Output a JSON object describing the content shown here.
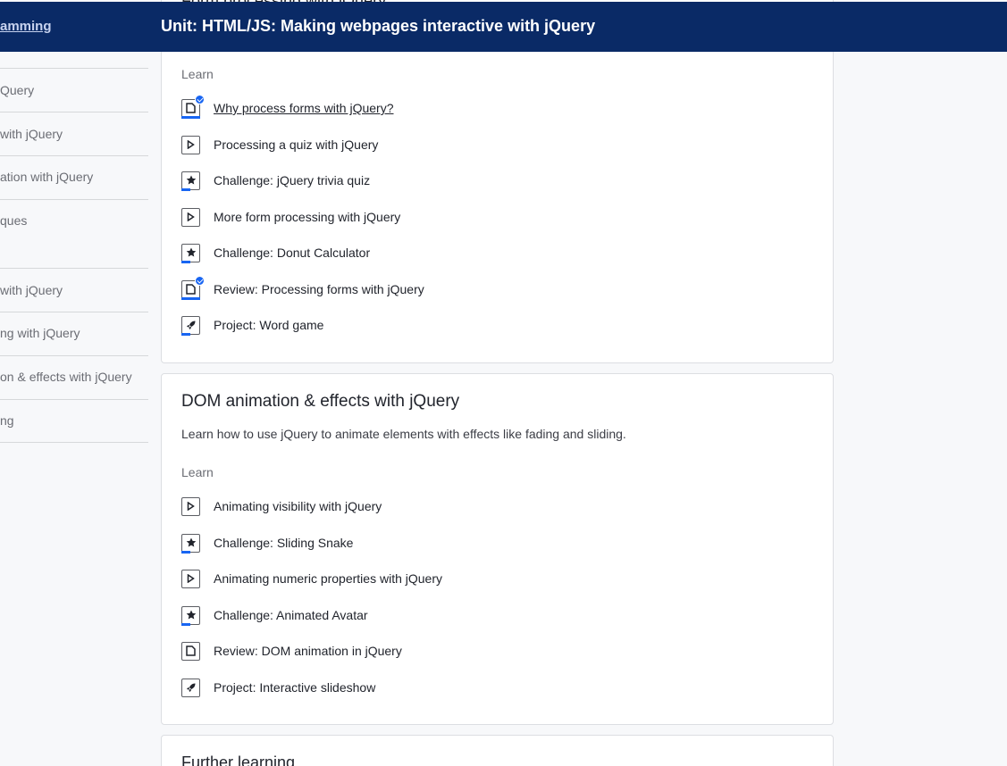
{
  "header": {
    "breadcrumb": "amming",
    "unit_title": "Unit: HTML/JS: Making webpages interactive with jQuery"
  },
  "sidebar": {
    "items": [
      {
        "label": "Query"
      },
      {
        "label": "with jQuery"
      },
      {
        "label": "ation with jQuery"
      },
      {
        "label": "ques"
      },
      {
        "label": "with jQuery"
      },
      {
        "label": "ng with jQuery"
      },
      {
        "label": "on & effects with jQuery"
      },
      {
        "label": "ng"
      }
    ]
  },
  "cards": [
    {
      "clipped_title": "Form processing with jQuery",
      "section_label": "Learn",
      "items": [
        {
          "label": "Why process forms with jQuery?",
          "icon": "article-icon",
          "completed": true
        },
        {
          "label": "Processing a quiz with jQuery",
          "icon": "video-icon"
        },
        {
          "label": "Challenge: jQuery trivia quiz",
          "icon": "challenge-star-icon"
        },
        {
          "label": "More form processing with jQuery",
          "icon": "video-icon"
        },
        {
          "label": "Challenge: Donut Calculator",
          "icon": "challenge-star-icon"
        },
        {
          "label": "Review: Processing forms with jQuery",
          "icon": "article-icon",
          "completed": true
        },
        {
          "label": "Project: Word game",
          "icon": "project-rocket-icon"
        }
      ]
    },
    {
      "title": "DOM animation & effects with jQuery",
      "description": "Learn how to use jQuery to animate elements with effects like fading and sliding.",
      "section_label": "Learn",
      "items": [
        {
          "label": "Animating visibility with jQuery",
          "icon": "video-icon"
        },
        {
          "label": "Challenge: Sliding Snake",
          "icon": "challenge-star-icon"
        },
        {
          "label": "Animating numeric properties with jQuery",
          "icon": "video-icon"
        },
        {
          "label": "Challenge: Animated Avatar",
          "icon": "challenge-star-icon"
        },
        {
          "label": "Review: DOM animation in jQuery",
          "icon": "article-icon"
        },
        {
          "label": "Project: Interactive slideshow",
          "icon": "project-rocket-icon"
        }
      ]
    },
    {
      "title": "Further learning"
    }
  ],
  "colors": {
    "header_bg": "#0a2a66",
    "accent": "#1865f2"
  }
}
